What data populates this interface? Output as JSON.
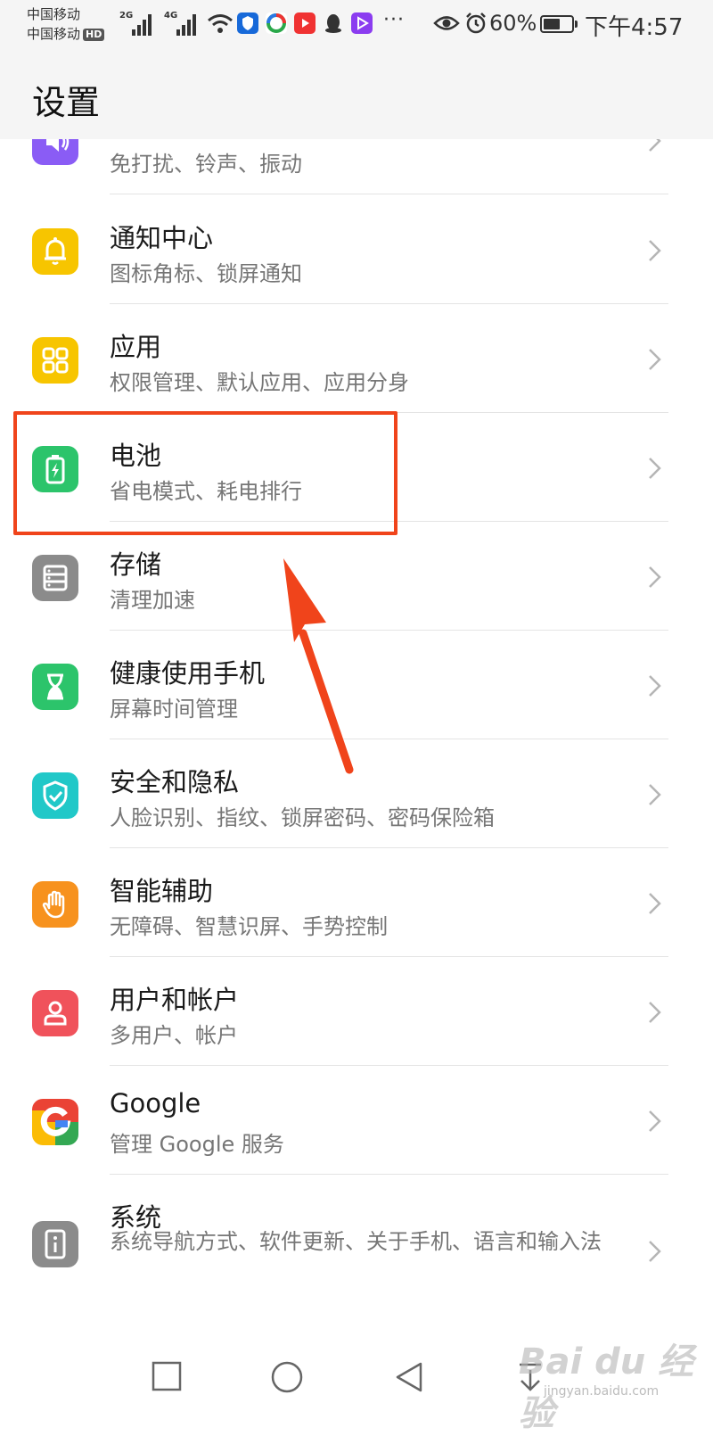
{
  "status_bar": {
    "carrier_1": "中国移动",
    "carrier_2": "中国移动",
    "hd_badge": "HD",
    "signal_1": "2G",
    "signal_2": "4G",
    "more": "···",
    "battery_percent": "60%",
    "battery_level": 0.6,
    "time": "下午4:57"
  },
  "header": {
    "title": "设置"
  },
  "items": [
    {
      "title": "",
      "subtitle": "免打扰、铃声、振动",
      "icon": "speaker-icon",
      "color": "#8a5cf5"
    },
    {
      "title": "通知中心",
      "subtitle": "图标角标、锁屏通知",
      "icon": "bell-icon",
      "color": "#f7c500"
    },
    {
      "title": "应用",
      "subtitle": "权限管理、默认应用、应用分身",
      "icon": "apps-grid-icon",
      "color": "#f7c500"
    },
    {
      "title": "电池",
      "subtitle": "省电模式、耗电排行",
      "icon": "battery-icon",
      "color": "#2cc46b"
    },
    {
      "title": "存储",
      "subtitle": "清理加速",
      "icon": "storage-icon",
      "color": "#8b8b8b"
    },
    {
      "title": "健康使用手机",
      "subtitle": "屏幕时间管理",
      "icon": "hourglass-icon",
      "color": "#2cc46b"
    },
    {
      "title": "安全和隐私",
      "subtitle": "人脸识别、指纹、锁屏密码、密码保险箱",
      "icon": "shield-icon",
      "color": "#21c8c8"
    },
    {
      "title": "智能辅助",
      "subtitle": "无障碍、智慧识屏、手势控制",
      "icon": "hand-icon",
      "color": "#f7921e"
    },
    {
      "title": "用户和帐户",
      "subtitle": "多用户、帐户",
      "icon": "user-icon",
      "color": "#f0525b"
    },
    {
      "title": "Google",
      "subtitle": "管理 Google 服务",
      "icon": "google-icon",
      "color": "#4285f4"
    },
    {
      "title": "系统",
      "subtitle": "系统导航方式、软件更新、关于手机、语言和输入法",
      "icon": "info-icon",
      "color": "#8b8b8b"
    }
  ],
  "annotation": {
    "color": "#f0441b"
  },
  "watermark": {
    "brand": "Bai du 经验",
    "url": "jingyan.baidu.com"
  }
}
